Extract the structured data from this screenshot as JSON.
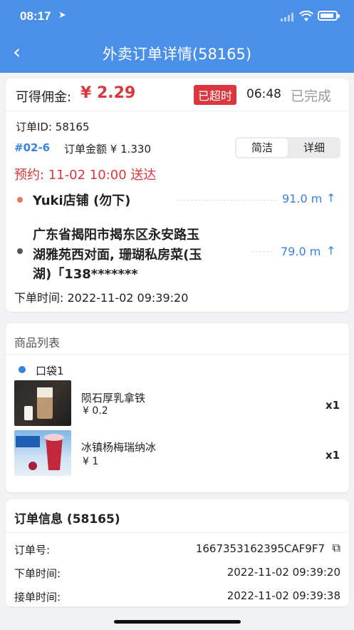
{
  "status_bar": {
    "time": "08:17"
  },
  "header": {
    "title": "外卖订单详情(58165)"
  },
  "summary": {
    "commission_label": "可得佣金:",
    "commission_value": "¥ 2.29",
    "overdue_badge": "已超时",
    "elapsed": "06:48",
    "status": "已完成",
    "order_id": "订单ID: 58165",
    "serial": "#02-6",
    "amount": "订单金额 ¥ 1.330",
    "view_simple": "简洁",
    "view_detail": "详细",
    "reservation": "预约: 11-02  10:00 送达",
    "shop_name": "Yuki店铺 (勿下)",
    "shop_distance": "91.0 m",
    "address_line1": "广东省揭阳市揭东区永安路玉",
    "address_line2": "湖雅苑西对面, 珊瑚私房菜(玉",
    "address_line3": "湖)「138*******",
    "address_distance": "79.0 m",
    "order_time": "下单时间: 2022-11-02 09:39:20"
  },
  "goods": {
    "title": "商品列表",
    "bag_label": "口袋1",
    "items": [
      {
        "name": "陨石厚乳拿铁",
        "price": "¥ 0.2",
        "qty": "x1"
      },
      {
        "name": "冰镇杨梅瑞纳冰",
        "price": "¥ 1",
        "qty": "x1"
      }
    ]
  },
  "order_info": {
    "title": "订单信息 (58165)",
    "rows": [
      {
        "label": "订单号:",
        "value": "1667353162395CAF9F7"
      },
      {
        "label": "下单时间:",
        "value": "2022-11-02 09:39:20"
      },
      {
        "label": "接单时间:",
        "value": "2022-11-02 09:39:38"
      }
    ]
  },
  "colors": {
    "header": "#4a90e8",
    "accent_red": "#d9363e",
    "accent_blue": "#3a82e0"
  }
}
